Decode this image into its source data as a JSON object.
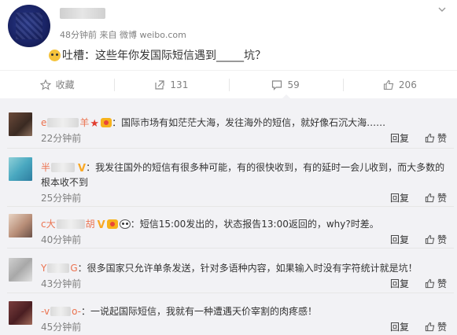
{
  "post": {
    "meta": "48分钟前 来自 微博 weibo.com",
    "text": "吐槽：这些年你发国际短信遇到_____坑？"
  },
  "actions": [
    {
      "label": "收藏",
      "icon": "star-icon"
    },
    {
      "label": "131",
      "icon": "repost-icon"
    },
    {
      "label": "59",
      "icon": "comment-icon"
    },
    {
      "label": "206",
      "icon": "like-icon"
    }
  ],
  "comments": [
    {
      "name_start": "e",
      "name_end": "羊",
      "text": "：国际市场有如茫茫大海，发往海外的短信，就好像石沉大海……",
      "time": "22分钟前",
      "reply": "回复",
      "like": "赞"
    },
    {
      "name_start": "半",
      "name_end": "",
      "text": "：我发往国外的短信有很多种可能，有的很快收到，有的延时一会儿收到，而大多数的",
      "text2": "根本收不到",
      "time": "25分钟前",
      "reply": "回复",
      "like": "赞"
    },
    {
      "name_start": "c大",
      "name_end": "胡",
      "text": "：短信15:00发出的，状态报告13:00返回的，why?时差。",
      "time": "40分钟前",
      "reply": "回复",
      "like": "赞"
    },
    {
      "name_start": "Y",
      "name_end": "G",
      "text": "：很多国家只允许单条发送，针对多语种内容，如果输入时没有字符统计就是坑！",
      "time": "43分钟前",
      "reply": "回复",
      "like": "赞"
    },
    {
      "name_start": "-v",
      "name_end": "o-",
      "text": "：一说起国际短信，我就有一种遭遇天价宰割的肉疼感！",
      "time": "45分钟前",
      "reply": "回复",
      "like": "赞"
    }
  ],
  "colors": {
    "name": "#eb7350",
    "accent": "#ff8200",
    "comments_bg": "#f2f2f5"
  }
}
